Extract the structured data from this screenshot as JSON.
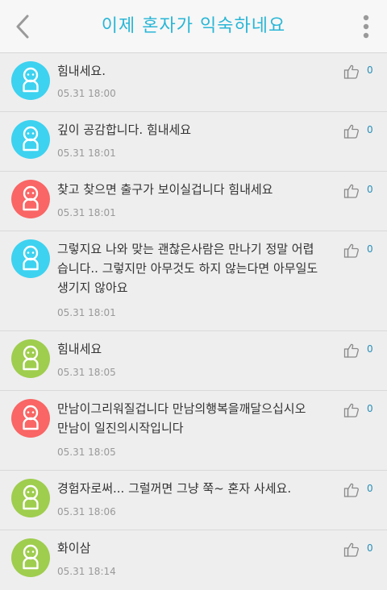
{
  "header": {
    "title": "이제 혼자가 익숙하네요"
  },
  "colors": {
    "accent": "#29b6d6",
    "avatar_blue": "#3dd2f0",
    "avatar_red": "#f96665",
    "avatar_green": "#9fcd4e",
    "count_color": "#2a8fb8"
  },
  "comments": [
    {
      "text": "힘내세요.",
      "time": "05.31 18:00",
      "likes": "0",
      "avatar_color": "#3dd2f0"
    },
    {
      "text": "깊이 공감합니다. 힘내세요",
      "time": "05.31 18:01",
      "likes": "0",
      "avatar_color": "#3dd2f0"
    },
    {
      "text": "찾고 찾으면 출구가 보이실겁니다 힘내세요",
      "time": "05.31 18:01",
      "likes": "0",
      "avatar_color": "#f96665"
    },
    {
      "text": "그렇지요 나와 맞는 괜찮은사람은 만나기 정말 어렵습니다.. 그렇지만 아무것도 하지 않는다면 아무일도 생기지 않아요",
      "time": "05.31 18:01",
      "likes": "0",
      "avatar_color": "#3dd2f0"
    },
    {
      "text": "힘내세요",
      "time": "05.31 18:05",
      "likes": "0",
      "avatar_color": "#9fcd4e"
    },
    {
      "text": "만남이그리워질겁니다 만남의행복을깨달으십시오 만남이 일진의시작입니다",
      "time": "05.31 18:05",
      "likes": "0",
      "avatar_color": "#f96665"
    },
    {
      "text": "경험자로써... 그럴꺼면 그냥 쭉~ 혼자 사세요.",
      "time": "05.31 18:06",
      "likes": "0",
      "avatar_color": "#9fcd4e"
    },
    {
      "text": "화이삼",
      "time": "05.31 18:14",
      "likes": "0",
      "avatar_color": "#9fcd4e"
    }
  ]
}
